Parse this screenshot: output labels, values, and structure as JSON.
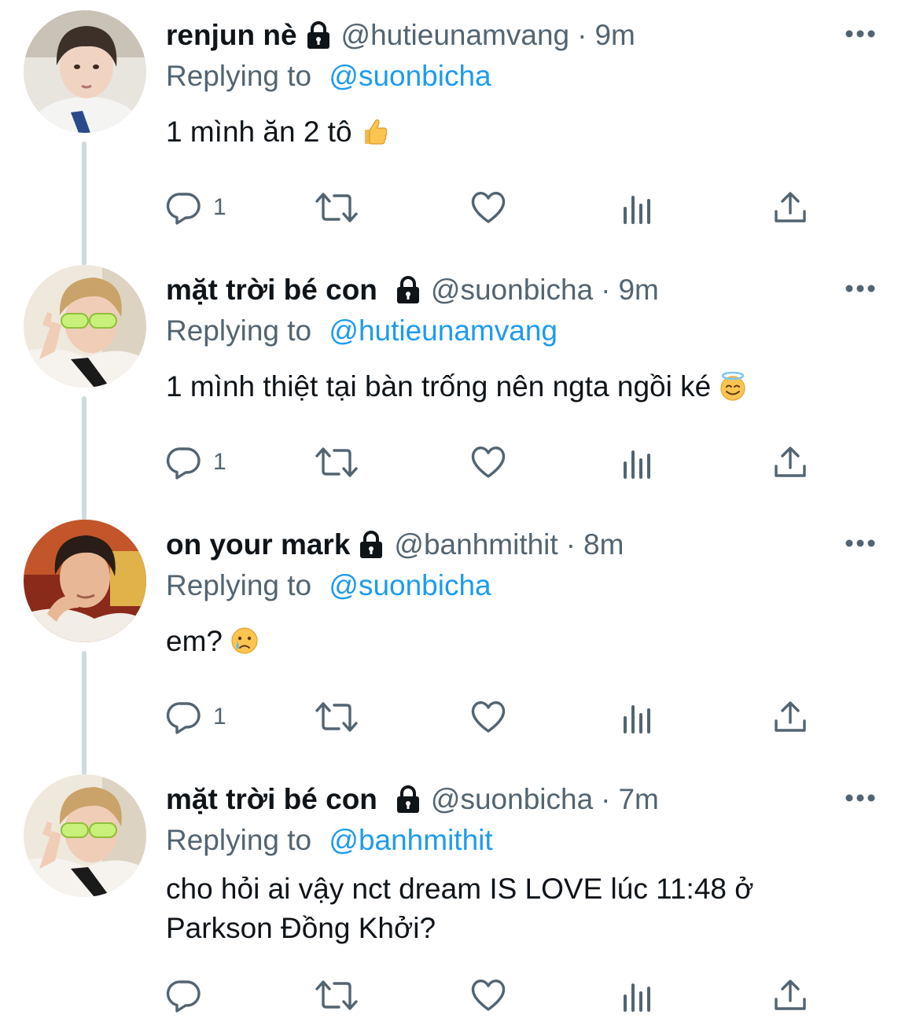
{
  "colors": {
    "text_primary": "#0f1419",
    "text_secondary": "#536471",
    "link": "#1d9bf0",
    "thread_line": "#cfd9de"
  },
  "tweets": [
    {
      "display_name": "renjun nè",
      "handle": "@hutieunamvang",
      "separator": "·",
      "time": "9m",
      "reply_prefix": "Replying to",
      "reply_to": "@suonbicha",
      "text": "1 mình ăn 2 tô",
      "emoji": "thumbs-up-emoji",
      "reply_count": "1",
      "locked": true
    },
    {
      "display_name": "mặt trời bé con",
      "handle": "@suonbicha",
      "separator": "·",
      "time": "9m",
      "reply_prefix": "Replying to",
      "reply_to": "@hutieunamvang",
      "text": "1 mình thiệt tại bàn trống nên ngta ngồi ké",
      "emoji": "smiling-face-with-halo-emoji",
      "reply_count": "1",
      "locked": true
    },
    {
      "display_name": "on your mark",
      "handle": "@banhmithit",
      "separator": "·",
      "time": "8m",
      "reply_prefix": "Replying to",
      "reply_to": "@suonbicha",
      "text": "em?",
      "emoji": "crying-face-emoji",
      "reply_count": "1",
      "locked": true
    },
    {
      "display_name": "mặt trời bé con",
      "handle": "@suonbicha",
      "separator": "·",
      "time": "7m",
      "reply_prefix": "Replying to",
      "reply_to": "@banhmithit",
      "text_line1": "cho hỏi ai vậy nct dream IS LOVE lúc 11:48 ở",
      "text_line2": "Parkson Đồng Khởi?",
      "reply_count": "",
      "locked": true
    }
  ],
  "icons": {
    "reply": "reply-icon",
    "retweet": "retweet-icon",
    "like": "heart-icon",
    "analytics": "analytics-icon",
    "share": "share-icon",
    "more": "more-options-icon",
    "lock": "lock-icon"
  }
}
